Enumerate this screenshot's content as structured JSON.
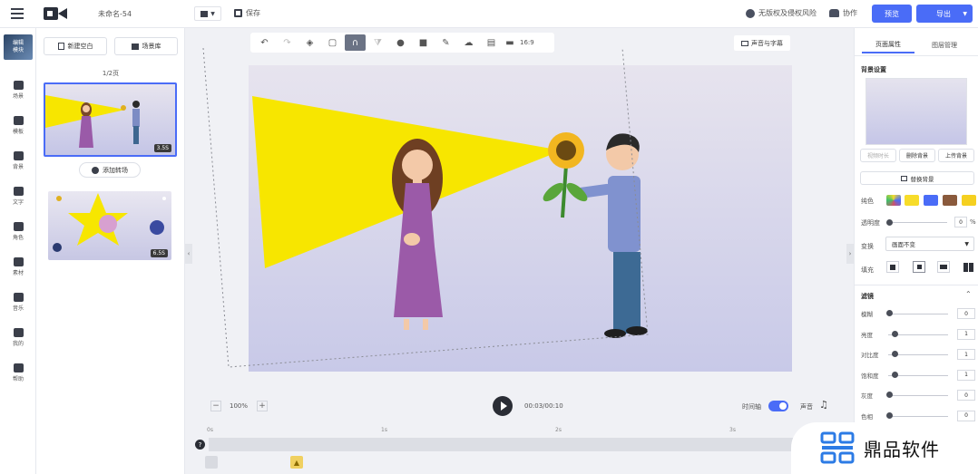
{
  "header": {
    "project_title": "未命名-54",
    "save_label": "保存",
    "copyright_notice": "无版权及侵权风险",
    "collab_label": "协作",
    "preview_label": "预览",
    "export_label": "导出"
  },
  "sidebar": {
    "logo_text": "编辑\n模块",
    "items": [
      {
        "label": "场景",
        "icon": "scene-icon"
      },
      {
        "label": "模板",
        "icon": "template-icon"
      },
      {
        "label": "背景",
        "icon": "background-icon"
      },
      {
        "label": "文字",
        "icon": "text-icon"
      },
      {
        "label": "角色",
        "icon": "character-icon"
      },
      {
        "label": "素材",
        "icon": "material-icon"
      },
      {
        "label": "音乐",
        "icon": "music-icon"
      },
      {
        "label": "我的",
        "icon": "my-icon"
      },
      {
        "label": "帮助",
        "icon": "help-icon"
      }
    ]
  },
  "scenes": {
    "new_blank_label": "新建空白",
    "library_label": "场景库",
    "page_indicator": "1/2页",
    "add_transition_label": "添加转场",
    "list": [
      {
        "duration": "3.5S"
      },
      {
        "duration": "6.5S"
      }
    ]
  },
  "toolbar": {
    "aspect_ratio": "16:9",
    "voice_subtitle_label": "声音与字幕"
  },
  "playback": {
    "zoom": "100%",
    "time": "00:03/00:10",
    "timeline_label": "时间轴",
    "sound_label": "声音",
    "ticks": [
      "0s",
      "1s",
      "2s",
      "3s"
    ]
  },
  "right_panel": {
    "tabs": [
      "页面属性",
      "图层管理"
    ],
    "bg_section": "背景设置",
    "bg_actions": [
      "视频时长",
      "删除背景",
      "上传背景"
    ],
    "replace_bg_label": "替换背景",
    "solid_color_label": "纯色",
    "opacity_label": "透明度",
    "opacity_value": "0",
    "opacity_unit": "%",
    "transform_label": "变换",
    "transform_value": "画面不变",
    "fill_label": "填充",
    "filter_section": "滤镜",
    "filters": [
      {
        "name": "模糊",
        "value": "0"
      },
      {
        "name": "亮度",
        "value": "1"
      },
      {
        "name": "对比度",
        "value": "1"
      },
      {
        "name": "饱和度",
        "value": "1"
      },
      {
        "name": "灰度",
        "value": "0"
      },
      {
        "name": "色相",
        "value": "0"
      }
    ]
  },
  "colors": {
    "accent": "#4a6cf7",
    "swatches": [
      "#f7dc2a",
      "#4a6cf7",
      "#8a5a3c",
      "#f5d020"
    ]
  },
  "watermark": {
    "text": "鼎品软件"
  }
}
